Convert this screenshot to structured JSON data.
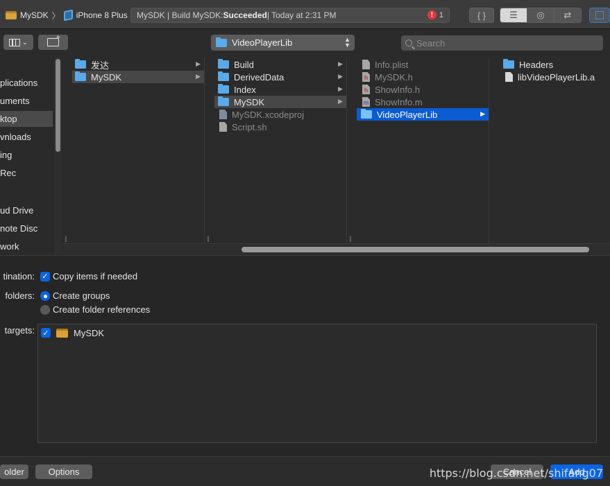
{
  "toolbar": {
    "scheme_name": "MySDK",
    "separator": "〉",
    "device_name": "iPhone 8 Plus",
    "activity_prefix": "MySDK | Build MySDK: ",
    "activity_status": "Succeeded",
    "activity_suffix": " | Today at 2:31 PM",
    "error_count": "1",
    "error_glyph": "!",
    "braces_label": "{ }"
  },
  "navigation": {
    "path_popup": "VideoPlayerLib",
    "search_placeholder": "Search"
  },
  "sidebar": {
    "items": [
      {
        "label": "plications",
        "selected": false
      },
      {
        "label": "uments",
        "selected": false
      },
      {
        "label": "ktop",
        "selected": true
      },
      {
        "label": "vnloads",
        "selected": false
      },
      {
        "label": "ing",
        "selected": false
      },
      {
        "label": "Rec",
        "selected": false
      },
      {
        "label": "ud Drive",
        "selected": false
      },
      {
        "label": "note Disc",
        "selected": false
      },
      {
        "label": "work",
        "selected": false
      }
    ]
  },
  "browser": {
    "columns": [
      {
        "items": [
          {
            "label": "发达",
            "kind": "folder",
            "arrow": true
          },
          {
            "label": "MySDK",
            "kind": "folder",
            "arrow": true,
            "selected": "grey"
          }
        ]
      },
      {
        "items": [
          {
            "label": "Build",
            "kind": "folder",
            "arrow": true
          },
          {
            "label": "DerivedData",
            "kind": "folder",
            "arrow": true
          },
          {
            "label": "Index",
            "kind": "folder",
            "arrow": true
          },
          {
            "label": "MySDK",
            "kind": "folder",
            "arrow": true,
            "selected": "grey"
          },
          {
            "label": "MySDK.xcodeproj",
            "kind": "project",
            "dim": true
          },
          {
            "label": "Script.sh",
            "kind": "file",
            "dim": true
          }
        ]
      },
      {
        "items": [
          {
            "label": "Info.plist",
            "kind": "file",
            "dim": true
          },
          {
            "label": "MySDK.h",
            "kind": "h",
            "dim": true
          },
          {
            "label": "ShowInfo.h",
            "kind": "h",
            "dim": true
          },
          {
            "label": "ShowInfo.m",
            "kind": "m",
            "dim": true
          },
          {
            "label": "VideoPlayerLib",
            "kind": "folder",
            "arrow": true,
            "selected": "blue"
          }
        ]
      },
      {
        "items": [
          {
            "label": "Headers",
            "kind": "folder"
          },
          {
            "label": "libVideoPlayerLib.a",
            "kind": "file"
          }
        ]
      }
    ]
  },
  "options": {
    "destination_label": "tination:",
    "copy_items_label": "Copy items if needed",
    "copy_items_checked": true,
    "folders_label": "folders:",
    "create_groups_label": "Create groups",
    "create_groups_selected": true,
    "create_refs_label": "Create folder references",
    "targets_label": "targets:",
    "targets": [
      {
        "name": "MySDK",
        "checked": true
      }
    ]
  },
  "bottom_bar": {
    "new_folder_label": "older",
    "options_label": "Options",
    "cancel_label": "Cancel",
    "add_label": "Add"
  },
  "watermark": "https://blog.csdn.net/shifang07",
  "colors": {
    "accent": "#0b64e0",
    "selection_blue": "#0b5bd3",
    "folder": "#5aa9e8",
    "background": "#2b2b2b"
  }
}
